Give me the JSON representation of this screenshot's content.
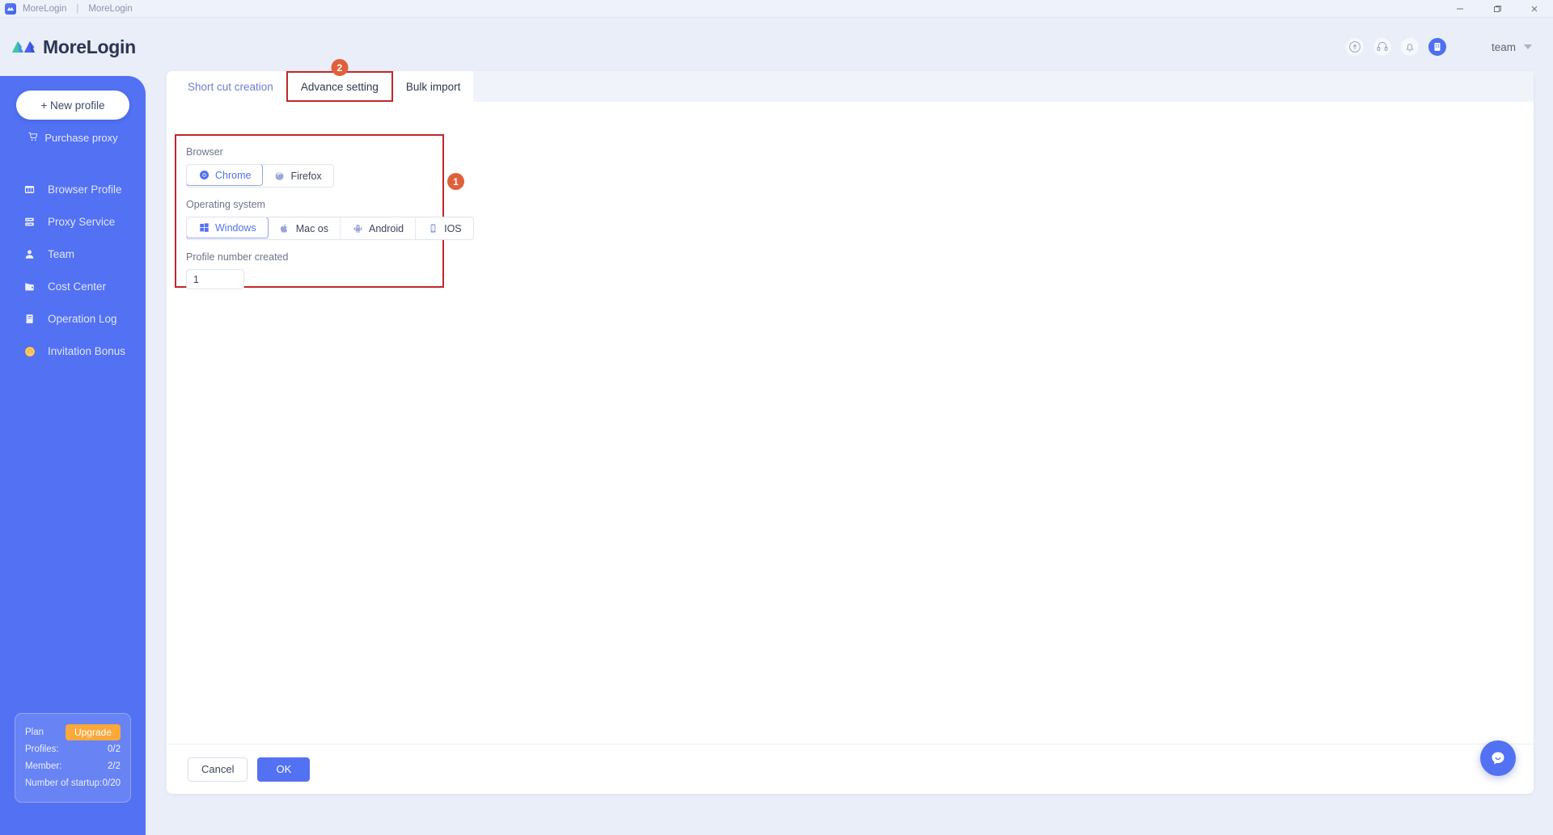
{
  "titlebar": {
    "app_name": "MoreLogin",
    "separator": "|",
    "window_title": "MoreLogin",
    "minimize_label": "—",
    "maximize_label": "❐",
    "close_label": "✕"
  },
  "header": {
    "brand": "MoreLogin",
    "icons": [
      {
        "name": "help-icon",
        "glyph": "?"
      },
      {
        "name": "headset-icon",
        "glyph": "headset"
      },
      {
        "name": "notification-bell-icon",
        "glyph": "bell"
      },
      {
        "name": "company-icon",
        "glyph": "building"
      }
    ],
    "user": "team"
  },
  "sidebar": {
    "new_profile_label": "+ New profile",
    "purchase_proxy_label": "Purchase proxy",
    "items": [
      {
        "label": "Browser Profile",
        "icon": "browser-icon"
      },
      {
        "label": "Proxy Service",
        "icon": "proxy-icon"
      },
      {
        "label": "Team",
        "icon": "user-icon"
      },
      {
        "label": "Cost Center",
        "icon": "wallet-icon"
      },
      {
        "label": "Operation Log",
        "icon": "log-icon"
      },
      {
        "label": "Invitation Bonus",
        "icon": "coin-icon"
      }
    ],
    "plan_card": {
      "plan_label": "Plan",
      "upgrade_label": "Upgrade",
      "rows": [
        {
          "label": "Profiles:",
          "value": "0/2"
        },
        {
          "label": "Member:",
          "value": "2/2"
        },
        {
          "label": "Number of startup:",
          "value": "0/20"
        }
      ]
    }
  },
  "main": {
    "tabs": [
      {
        "label": "Short cut creation",
        "active": false,
        "highlight": false,
        "badge": null
      },
      {
        "label": "Advance setting",
        "active": true,
        "highlight": true,
        "badge": "2"
      },
      {
        "label": "Bulk import",
        "active": false,
        "highlight": false,
        "badge": null
      }
    ],
    "settings": {
      "browser_label": "Browser",
      "browser_options": [
        {
          "label": "Chrome",
          "icon": "chrome-icon",
          "selected": true
        },
        {
          "label": "Firefox",
          "icon": "firefox-icon",
          "selected": false
        }
      ],
      "os_label": "Operating system",
      "os_options": [
        {
          "label": "Windows",
          "icon": "windows-icon",
          "selected": true
        },
        {
          "label": "Mac os",
          "icon": "apple-icon",
          "selected": false
        },
        {
          "label": "Android",
          "icon": "android-icon",
          "selected": false
        },
        {
          "label": "IOS",
          "icon": "ios-icon",
          "selected": false
        }
      ],
      "profile_number_label": "Profile number created",
      "profile_number_value": "1",
      "annotation_badge": "1"
    },
    "footer": {
      "cancel_label": "Cancel",
      "ok_label": "OK"
    },
    "chat_fab": "chat-bubble-icon"
  },
  "colors": {
    "sidebar_bg": "#5271f3",
    "accent": "#5271f3",
    "annotation_red": "#c0282a",
    "badge_orange": "#e0603c",
    "upgrade_orange": "#f9a83a"
  }
}
